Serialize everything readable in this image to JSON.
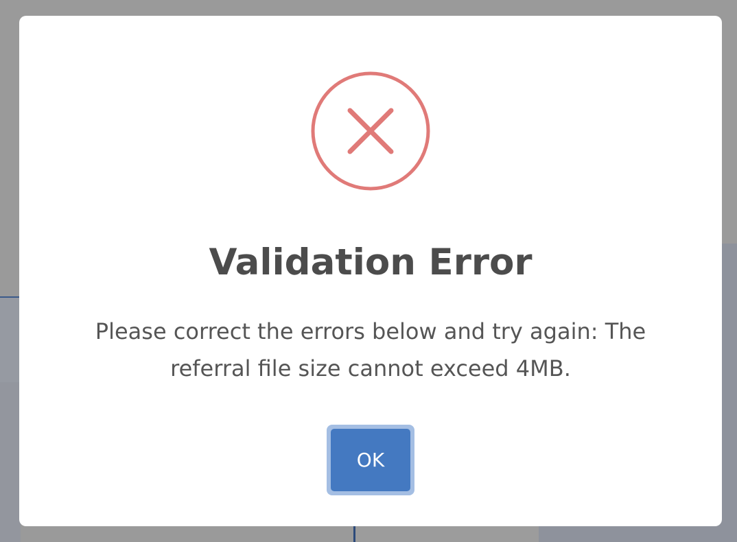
{
  "dialog": {
    "icon": "error-circle-x-icon",
    "title": "Validation Error",
    "message": "Please correct the errors below and try again: The referral file size cannot exceed 4MB.",
    "ok_label": "OK"
  },
  "colors": {
    "icon": "#e07a78",
    "title": "#4c4c4c",
    "message": "#555555",
    "button": "#4479c1",
    "button_focus_ring": "#a4bee3",
    "overlay": "#9a9a9a"
  }
}
